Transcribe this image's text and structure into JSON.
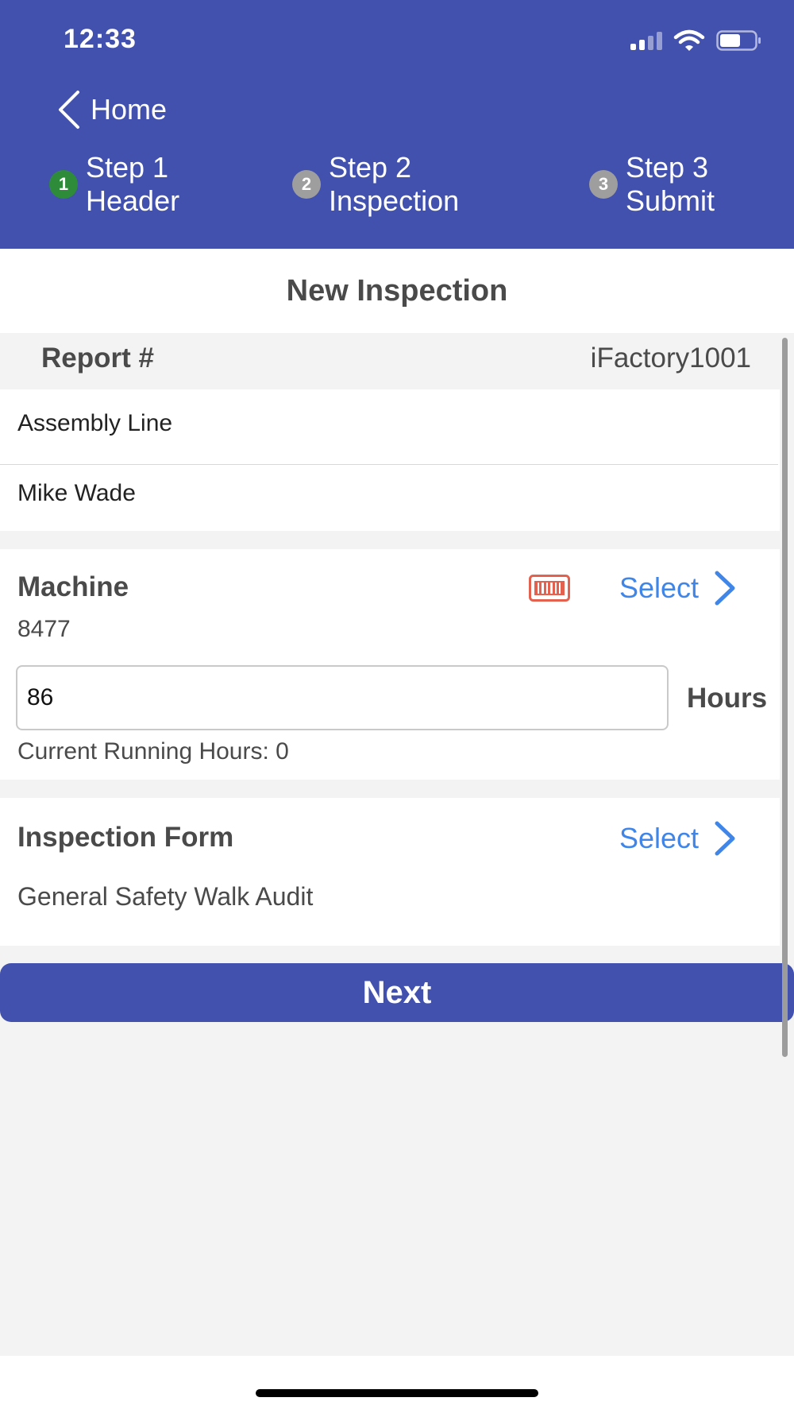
{
  "status_bar": {
    "time": "12:33",
    "icons": [
      "cellular-signal-icon",
      "wifi-icon",
      "battery-icon"
    ]
  },
  "nav": {
    "back_label": "Home",
    "steps": [
      {
        "badge": "1",
        "label_line1": "Step 1",
        "label_line2": "Header",
        "badge_color": "#2e8b3a",
        "state": "current"
      },
      {
        "badge": "2",
        "label_line1": "Step 2",
        "label_line2": "Inspection",
        "badge_color": "#9e9e9e",
        "state": "pending"
      },
      {
        "badge": "3",
        "label_line1": "Step 3",
        "label_line2": "Submit",
        "badge_color": "#9e9e9e",
        "state": "pending"
      }
    ]
  },
  "page": {
    "title": "New Inspection"
  },
  "report": {
    "label": "Report #",
    "value": "iFactory1001"
  },
  "info": {
    "location": "Assembly Line",
    "inspector": "Mike Wade"
  },
  "machine": {
    "heading": "Machine",
    "select_label": "Select",
    "value": "8477",
    "hours_input_value": "86",
    "hours_unit": "Hours",
    "running_hours_text": "Current Running Hours: 0"
  },
  "inspection_form": {
    "heading": "Inspection Form",
    "select_label": "Select",
    "value": "General Safety Walk Audit"
  },
  "actions": {
    "next_label": "Next"
  },
  "colors": {
    "primary": "#4251ae",
    "link": "#3f86e8",
    "barcode": "#e2624f",
    "step_active": "#2e8b3a",
    "step_inactive": "#9e9e9e"
  }
}
